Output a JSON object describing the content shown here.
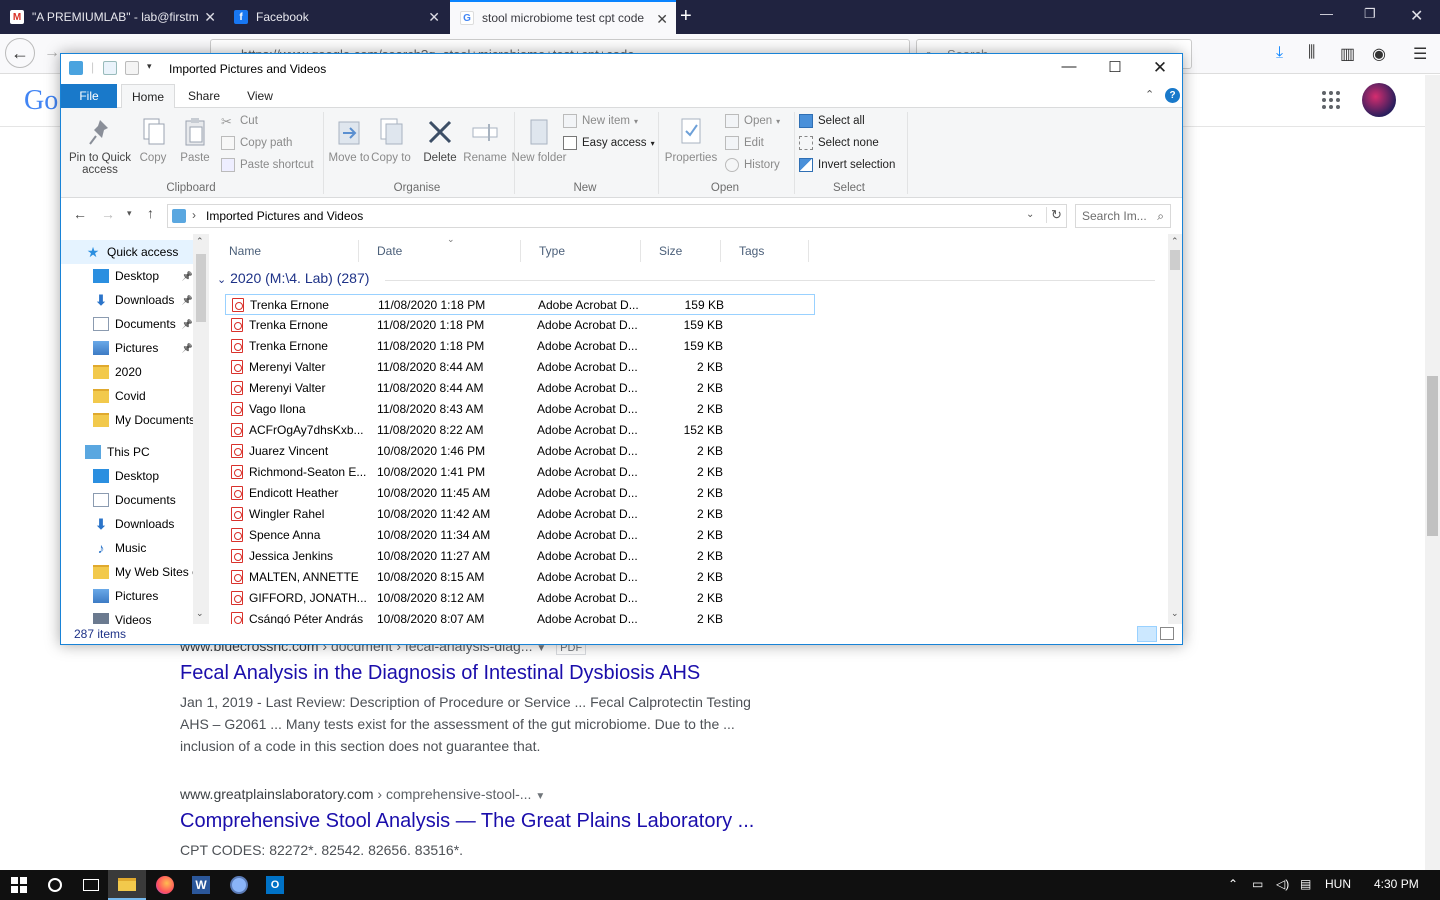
{
  "browser": {
    "tabs": [
      {
        "label": "\"A PREMIUMLAB\" - lab@firstm",
        "icon": "gmail-icon",
        "active": false
      },
      {
        "label": "Facebook",
        "icon": "facebook-icon",
        "active": false
      },
      {
        "label": "stool microbiome test cpt code",
        "icon": "google-icon",
        "active": true
      }
    ],
    "url": "https://www.google.com/search?q=stool+microbiome+test+cpt+code",
    "search_placeholder": "Search"
  },
  "google": {
    "logo": "Go"
  },
  "results": [
    {
      "url": "www.bluecrossnc.com",
      "crumb": " › document › fecal-analysis-diag...",
      "badge": "PDF",
      "title": "Fecal Analysis in the Diagnosis of Intestinal Dysbiosis AHS",
      "snippet_lines": [
        "Jan 1, 2019 - Last Review: Description of Procedure or Service ... Fecal Calprotectin Testing",
        "AHS – G2061 ... Many tests exist for the assessment of the gut microbiome. Due to the ...",
        "inclusion of a code in this section does not guarantee that."
      ]
    },
    {
      "url": "www.greatplainslaboratory.com",
      "crumb": " › comprehensive-stool-...",
      "title": "Comprehensive Stool Analysis — The Great Plains Laboratory ...",
      "snippet_lines": [
        "CPT CODES: 82272*. 82542. 82656. 83516*."
      ]
    }
  ],
  "explorer": {
    "title": "Imported Pictures and Videos",
    "ribbon_tabs": [
      "File",
      "Home",
      "Share",
      "View"
    ],
    "clipboard": {
      "pin": "Pin to Quick access",
      "copy": "Copy",
      "paste": "Paste",
      "cut": "Cut",
      "copy_path": "Copy path",
      "paste_shortcut": "Paste shortcut",
      "label": "Clipboard"
    },
    "organise": {
      "move_to": "Move to",
      "copy_to": "Copy to",
      "delete": "Delete",
      "rename": "Rename",
      "label": "Organise"
    },
    "new": {
      "new_folder": "New folder",
      "new_item": "New item",
      "easy_access": "Easy access",
      "label": "New"
    },
    "open": {
      "properties": "Properties",
      "open": "Open",
      "edit": "Edit",
      "history": "History",
      "label": "Open"
    },
    "select": {
      "select_all": "Select all",
      "select_none": "Select none",
      "invert": "Invert selection",
      "label": "Select"
    },
    "address": "Imported Pictures and Videos",
    "search_placeholder": "Search Im...",
    "nav": [
      {
        "label": "Quick access",
        "icon": "star-icon",
        "pinned": false
      },
      {
        "label": "Desktop",
        "icon": "desktop-icon",
        "pinned": true
      },
      {
        "label": "Downloads",
        "icon": "download-arrow-icon",
        "pinned": true
      },
      {
        "label": "Documents",
        "icon": "document-icon",
        "pinned": true
      },
      {
        "label": "Pictures",
        "icon": "pictures-icon",
        "pinned": true
      },
      {
        "label": "2020",
        "icon": "folder-icon",
        "pinned": false
      },
      {
        "label": "Covid",
        "icon": "folder-icon",
        "pinned": false
      },
      {
        "label": "My Documents",
        "icon": "folder-icon",
        "pinned": false
      },
      {
        "label": "This PC",
        "icon": "computer-icon",
        "pinned": false
      },
      {
        "label": "Desktop",
        "icon": "desktop-icon",
        "pinned": false
      },
      {
        "label": "Documents",
        "icon": "document-icon",
        "pinned": false
      },
      {
        "label": "Downloads",
        "icon": "download-arrow-icon",
        "pinned": false
      },
      {
        "label": "Music",
        "icon": "music-icon",
        "pinned": false
      },
      {
        "label": "My Web Sites c",
        "icon": "folder-icon",
        "pinned": false
      },
      {
        "label": "Pictures",
        "icon": "pictures-icon",
        "pinned": false
      },
      {
        "label": "Videos",
        "icon": "video-icon",
        "pinned": false
      }
    ],
    "columns": [
      "Name",
      "Date",
      "Type",
      "Size",
      "Tags"
    ],
    "group": "2020 (M:\\4. Lab) (287)",
    "files": [
      {
        "name": "Trenka Ernone",
        "date": "11/08/2020 1:18 PM",
        "type": "Adobe Acrobat D...",
        "size": "159 KB"
      },
      {
        "name": "Trenka Ernone",
        "date": "11/08/2020 1:18 PM",
        "type": "Adobe Acrobat D...",
        "size": "159 KB"
      },
      {
        "name": "Trenka Ernone",
        "date": "11/08/2020 1:18 PM",
        "type": "Adobe Acrobat D...",
        "size": "159 KB"
      },
      {
        "name": "Merenyi Valter",
        "date": "11/08/2020 8:44 AM",
        "type": "Adobe Acrobat D...",
        "size": "2 KB"
      },
      {
        "name": "Merenyi Valter",
        "date": "11/08/2020 8:44 AM",
        "type": "Adobe Acrobat D...",
        "size": "2 KB"
      },
      {
        "name": "Vago Ilona",
        "date": "11/08/2020 8:43 AM",
        "type": "Adobe Acrobat D...",
        "size": "2 KB"
      },
      {
        "name": "ACFrOgAy7dhsKxb...",
        "date": "11/08/2020 8:22 AM",
        "type": "Adobe Acrobat D...",
        "size": "152 KB"
      },
      {
        "name": "Juarez Vincent",
        "date": "10/08/2020 1:46 PM",
        "type": "Adobe Acrobat D...",
        "size": "2 KB"
      },
      {
        "name": "Richmond-Seaton E...",
        "date": "10/08/2020 1:41 PM",
        "type": "Adobe Acrobat D...",
        "size": "2 KB"
      },
      {
        "name": "Endicott Heather",
        "date": "10/08/2020 11:45 AM",
        "type": "Adobe Acrobat D...",
        "size": "2 KB"
      },
      {
        "name": "Wingler Rahel",
        "date": "10/08/2020 11:42 AM",
        "type": "Adobe Acrobat D...",
        "size": "2 KB"
      },
      {
        "name": "Spence Anna",
        "date": "10/08/2020 11:34 AM",
        "type": "Adobe Acrobat D...",
        "size": "2 KB"
      },
      {
        "name": "Jessica Jenkins",
        "date": "10/08/2020 11:27 AM",
        "type": "Adobe Acrobat D...",
        "size": "2 KB"
      },
      {
        "name": "MALTEN, ANNETTE",
        "date": "10/08/2020 8:15 AM",
        "type": "Adobe Acrobat D...",
        "size": "2 KB"
      },
      {
        "name": "GIFFORD, JONATH...",
        "date": "10/08/2020 8:12 AM",
        "type": "Adobe Acrobat D...",
        "size": "2 KB"
      },
      {
        "name": "Csángó Péter András",
        "date": "10/08/2020 8:07 AM",
        "type": "Adobe Acrobat D...",
        "size": "2 KB"
      }
    ],
    "status": "287 items"
  },
  "tray": {
    "lang": "HUN",
    "time": "4:30 PM"
  }
}
